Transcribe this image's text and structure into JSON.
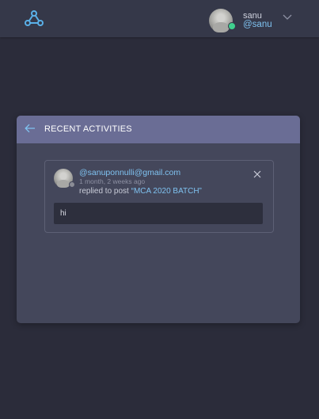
{
  "header": {
    "logo_icon": "network-logo-icon",
    "user": {
      "name": "sanu",
      "handle": "@sanu",
      "online": true,
      "status_color": "#3fd08e"
    },
    "menu_icon": "chevron-down-icon"
  },
  "panel": {
    "back_icon": "arrow-left-icon",
    "title": "RECENT ACTIVITIES",
    "header_color": "#6a6d95",
    "activities": [
      {
        "email": "@sanuponnulli@gmail.com",
        "time": "1 month, 2 weeks ago",
        "action": "replied to post ",
        "post_title": "“MCA 2020 BATCH”",
        "message": "hi",
        "close_icon": "close-icon"
      }
    ]
  },
  "colors": {
    "background": "#2b2c3a",
    "topbar": "#353849",
    "panel": "#44475b",
    "accent": "#7fc2f0"
  }
}
